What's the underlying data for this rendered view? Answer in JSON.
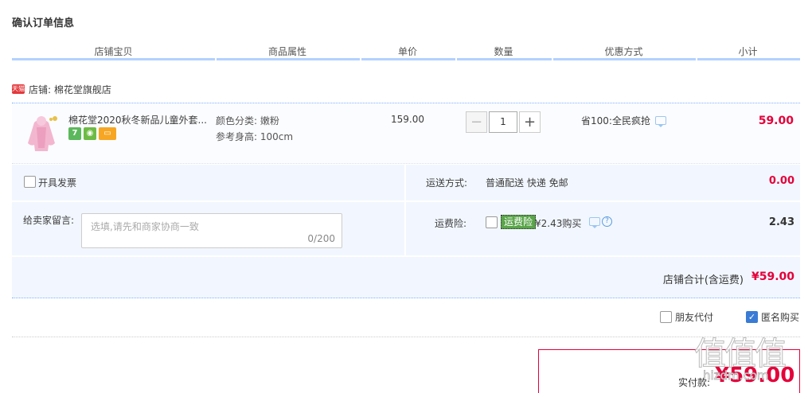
{
  "page_title": "确认订单信息",
  "columns": [
    "店铺宝贝",
    "商品属性",
    "单价",
    "数量",
    "优惠方式",
    "小计"
  ],
  "shop": {
    "badge": "天猫",
    "label": "店铺: 棉花堂旗舰店"
  },
  "item": {
    "title": "棉花堂2020秋冬新品儿童外套...",
    "badge_seven": "7",
    "color": "颜色分类: 嫩粉",
    "height": "参考身高: 100cm",
    "price": "159.00",
    "qty_minus": "−",
    "qty": "1",
    "qty_plus": "+",
    "promo": "省100:全民疯抢",
    "subtotal": "59.00"
  },
  "invoice_label": "开具发票",
  "message": {
    "label": "给卖家留言:",
    "placeholder": "选填,请先和商家协商一致",
    "count": "0/200"
  },
  "shipping": {
    "label": "运送方式:",
    "method": "普通配送 快递 免邮",
    "fee": "0.00"
  },
  "insurance": {
    "label": "运费险:",
    "tag": "运费险",
    "price": "¥2.43购买",
    "value": "2.43",
    "help": "?"
  },
  "shop_total": {
    "label": "店铺合计(含运费)",
    "value": "¥59.00"
  },
  "options": {
    "friend_pay": "朋友代付",
    "anonymous": "匿名购买",
    "anonymous_check": "✓"
  },
  "pay": {
    "label": "实付款:",
    "value": "¥59.00"
  },
  "watermark": {
    "text": "值值值",
    "url": "hizdm.com"
  },
  "colors": {
    "price_red": "#e4003a",
    "header_line": "#b2d1ff",
    "panel_bg": "#f2f7ff",
    "insurance_green": "#5aa54a"
  }
}
